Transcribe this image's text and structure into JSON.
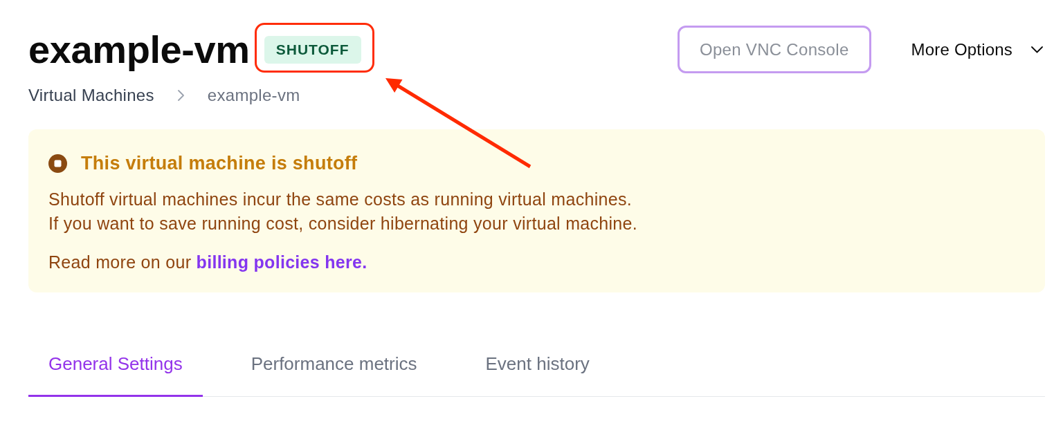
{
  "header": {
    "title": "example-vm",
    "badge": {
      "label": "SHUTOFF",
      "highlighted": true
    },
    "actions": [
      {
        "kind": "outline",
        "label": "Open VNC Console",
        "disabled": true
      },
      {
        "kind": "menu",
        "label": "More Options",
        "disabled": false
      }
    ]
  },
  "breadcrumb": [
    {
      "label": "Virtual Machines",
      "current": false
    },
    {
      "label": "example-vm",
      "current": true
    }
  ],
  "alert": {
    "title": "This virtual machine is shutoff",
    "lines": [
      "Shutoff virtual machines incur the same costs as running virtual machines.",
      "If you want to save running cost, consider hibernating your virtual machine."
    ],
    "footer": "Read more on our",
    "link": "billing policies here."
  },
  "tabs": [
    {
      "label": "General Settings",
      "selected": true
    },
    {
      "label": "Performance metrics",
      "selected": false
    },
    {
      "label": "Event history",
      "selected": false
    }
  ]
}
